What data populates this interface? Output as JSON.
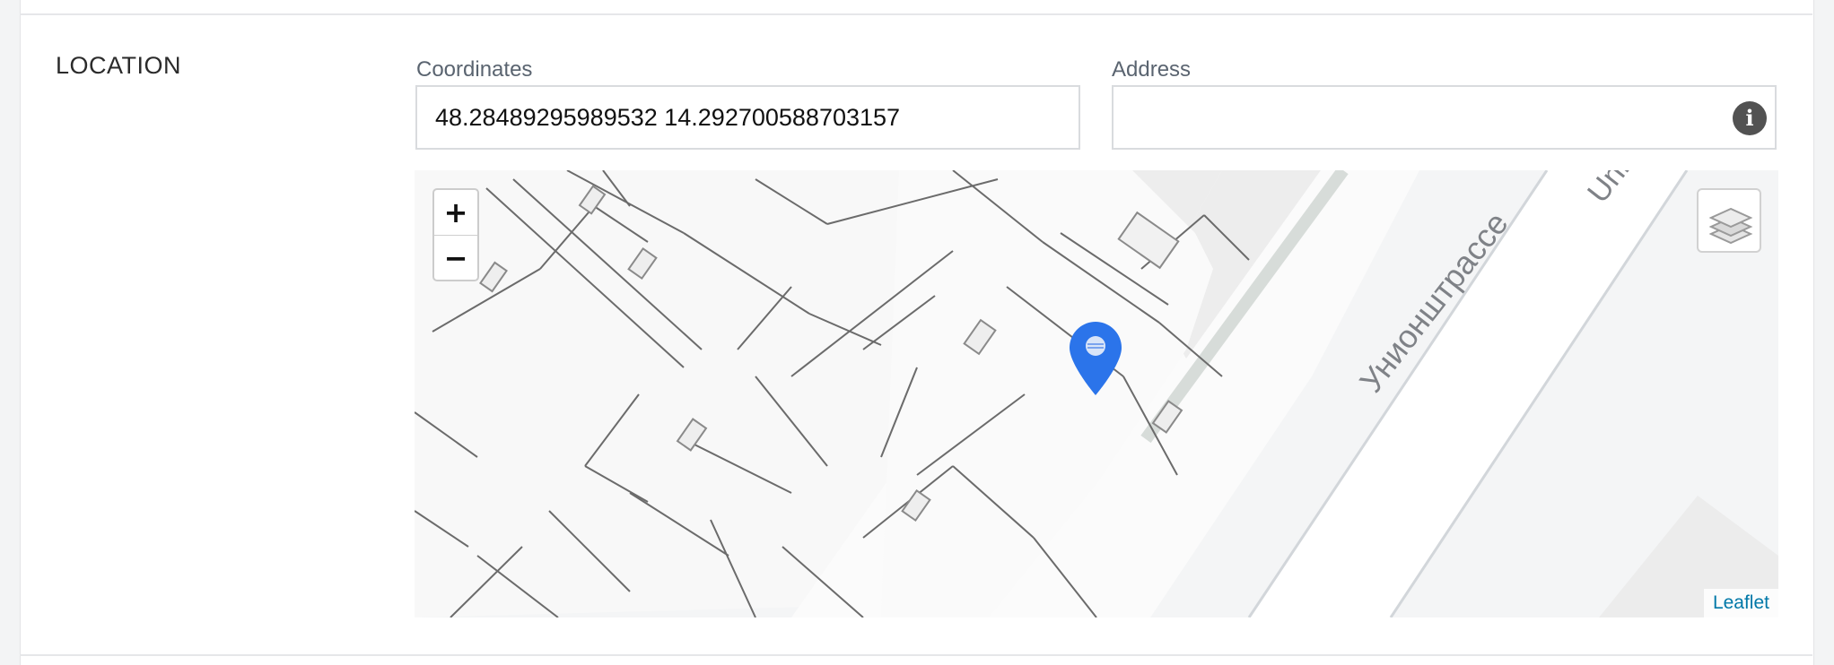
{
  "section": {
    "title": "LOCATION"
  },
  "coordinates": {
    "label": "Coordinates",
    "value": "48.28489295989532 14.292700588703157"
  },
  "address": {
    "label": "Address",
    "value": "",
    "info_icon": "info-icon",
    "info_glyph": "i"
  },
  "map": {
    "zoom_in": "+",
    "zoom_out": "−",
    "street_label": "Унионштрассе",
    "street_label_partial": "Uni",
    "attribution": "Leaflet",
    "marker_color": "#2b74ea",
    "layers_icon": "layers-icon"
  }
}
